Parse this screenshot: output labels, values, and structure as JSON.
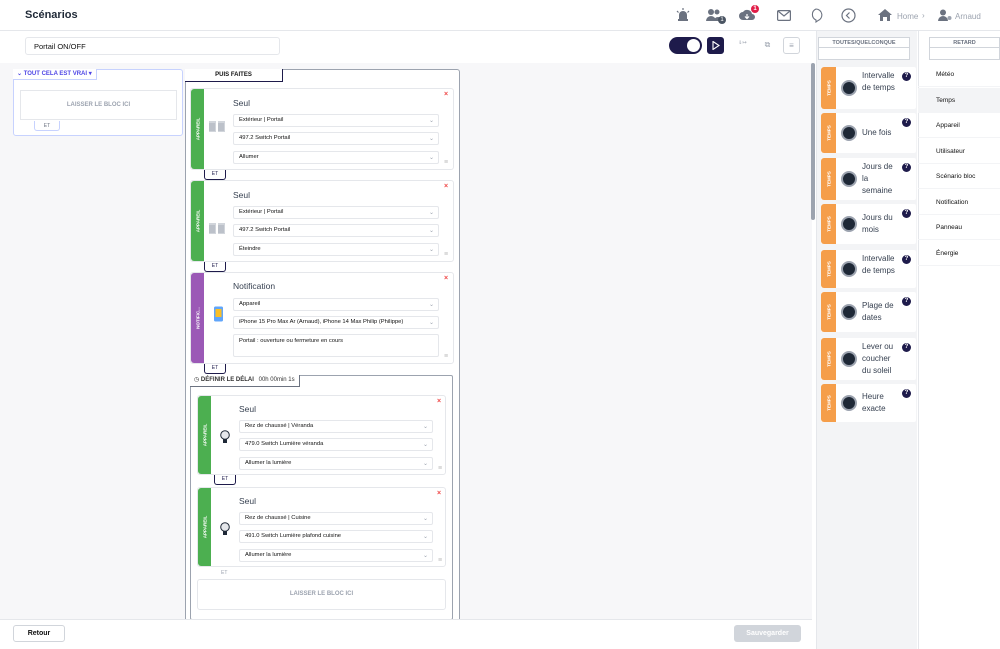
{
  "header": {
    "title": "Scénarios",
    "nav_home": "Home",
    "user_name": "Arnaud",
    "notif_count": "1",
    "users_count": "1"
  },
  "toolbar": {
    "scenario_name": "Portail ON/OFF"
  },
  "conditions": {
    "header": "TOUT CELA EST VRAI",
    "drop_label": "LAISSER LE BLOC ICI",
    "et_label": "ET"
  },
  "actions": {
    "header": "PUIS FAITES",
    "blocks": [
      {
        "category": "APPAREIL",
        "title": "Seul",
        "location": "Extérieur | Portail",
        "device": "497.2 Switch Portail",
        "action": "Allumer"
      },
      {
        "category": "APPAREIL",
        "title": "Seul",
        "location": "Extérieur | Portail",
        "device": "497.2 Switch Portail",
        "action": "Éteindre"
      }
    ],
    "notification": {
      "category": "NOTIFIC...",
      "title": "Notification",
      "type": "Appareil",
      "recipients": "iPhone 15 Pro Max Ar (Arnaud), iPhone 14 Max Philip (Philippe)",
      "message": "Portail : ouverture ou fermeture en cours"
    },
    "et_label": "ET",
    "delay": {
      "label": "DÉFINIR LE DÉLAI",
      "value": "00h 00min 1s",
      "blocks": [
        {
          "category": "APPAREIL",
          "title": "Seul",
          "location": "Rez de chaussé | Véranda",
          "device": "479.0 Switch Lumière véranda",
          "action": "Allumer la lumière"
        },
        {
          "category": "APPAREIL",
          "title": "Seul",
          "location": "Rez de chaussé | Cuisine",
          "device": "491.0 Switch Lumière plafond cuisine",
          "action": "Allumer la lumière"
        }
      ],
      "drop_label": "LAISSER LE BLOC ICI",
      "et_label": "ET"
    }
  },
  "footer": {
    "back_label": "Retour",
    "save_label": "Sauvegarder"
  },
  "palette": {
    "tab_all": "TOUTES/QUELCONQUE",
    "tab_delay": "RETARD",
    "items": [
      {
        "category": "TEMPS",
        "label": "Intervalle de temps"
      },
      {
        "category": "TEMPS",
        "label": "Une fois"
      },
      {
        "category": "TEMPS",
        "label": "Jours de la semaine"
      },
      {
        "category": "TEMPS",
        "label": "Jours du mois"
      },
      {
        "category": "TEMPS",
        "label": "Intervalle de temps"
      },
      {
        "category": "TEMPS",
        "label": "Plage de dates"
      },
      {
        "category": "TEMPS",
        "label": "Lever ou coucher du soleil"
      },
      {
        "category": "TEMPS",
        "label": "Heure exacte"
      }
    ],
    "help_mark": "?"
  },
  "categories": [
    "Météo",
    "Temps",
    "Appareil",
    "Utilisateur",
    "Scénario bloc",
    "Notification",
    "Panneau",
    "Énergie"
  ],
  "active_category": "Temps",
  "colors": {
    "accent": "#1e1b4b",
    "device": "#4caf50",
    "notification": "#9b59b6",
    "time": "#f59e4a",
    "danger": "#ef4444"
  }
}
